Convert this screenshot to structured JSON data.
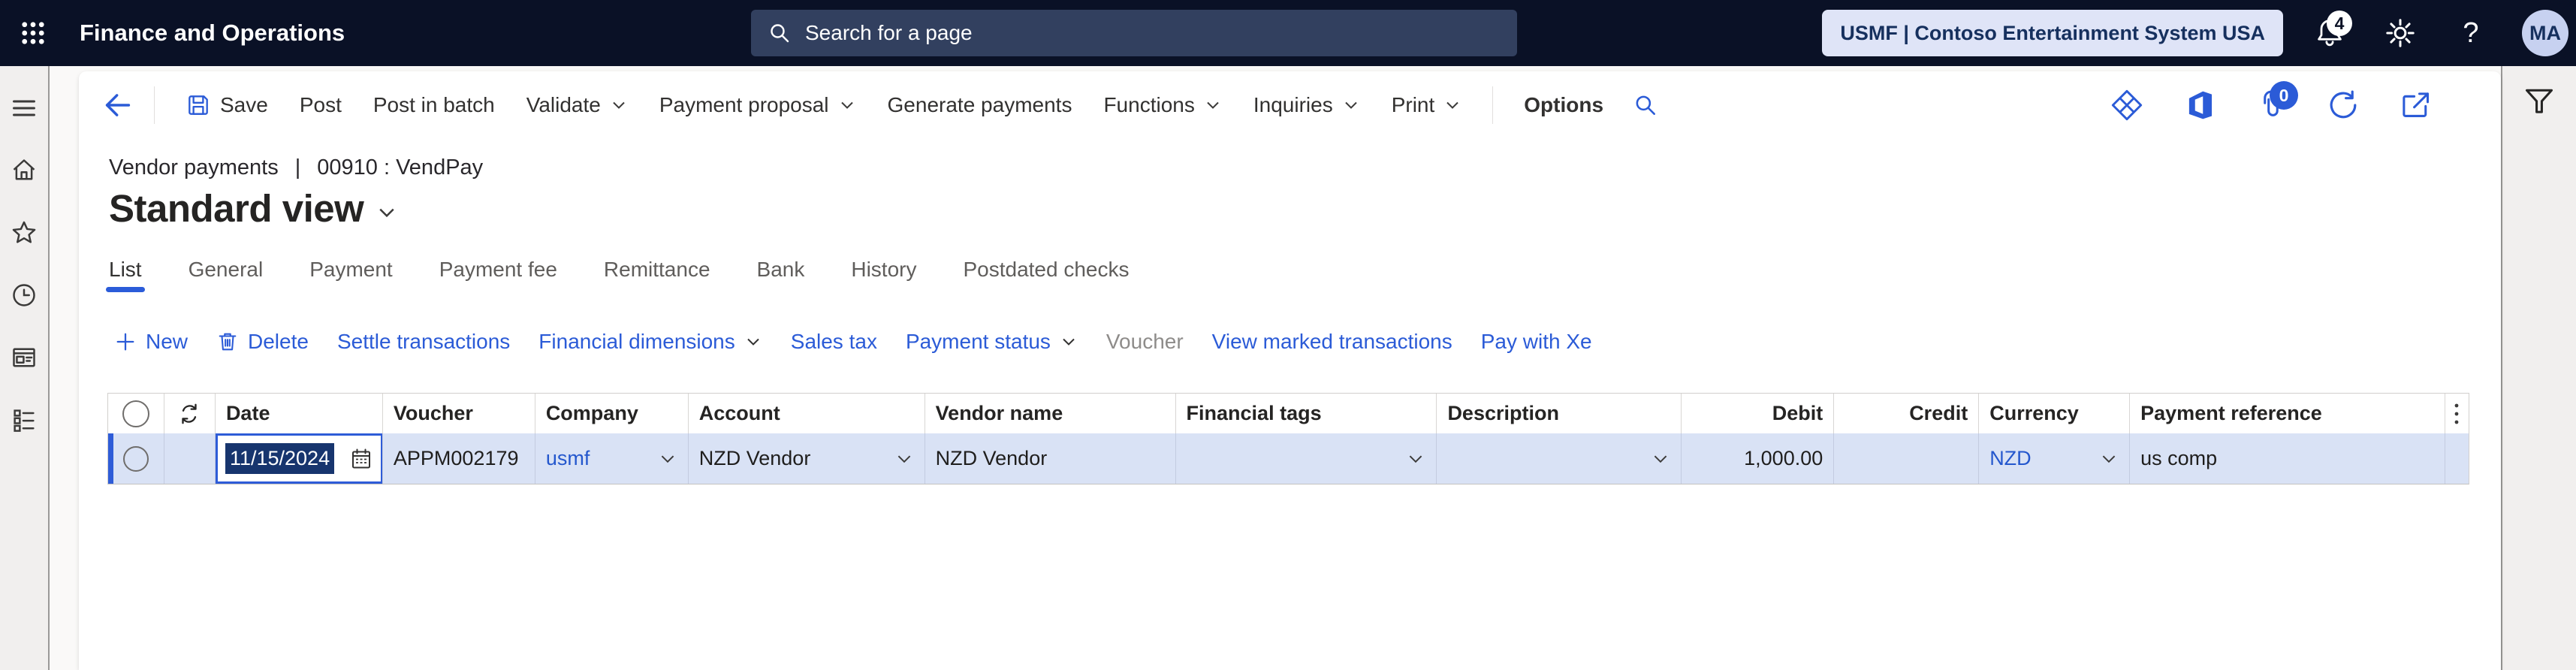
{
  "colors": {
    "topbar_bg": "#0a1126",
    "accent_blue": "#2b5bd7",
    "link_blue": "#2457cd",
    "row_selection_bg": "#d9e2f5",
    "environment_pill_bg": "#dfe4f7",
    "tab_underline": "#2b5cd9"
  },
  "topbar": {
    "app_title": "Finance and Operations",
    "search_placeholder": "Search for a page",
    "environment": "USMF | Contoso Entertainment System USA",
    "notification_count": "4",
    "help_label": "?",
    "avatar_initials": "MA"
  },
  "action_pane": {
    "save": "Save",
    "post": "Post",
    "post_in_batch": "Post in batch",
    "validate": "Validate",
    "payment_proposal": "Payment proposal",
    "generate_payments": "Generate payments",
    "functions": "Functions",
    "inquiries": "Inquiries",
    "print": "Print",
    "options": "Options",
    "attachments_count": "0"
  },
  "breadcrumb": {
    "page": "Vendor payments",
    "separator": "|",
    "record": "00910 : VendPay"
  },
  "page": {
    "title": "Standard view"
  },
  "tabs": [
    {
      "label": "List"
    },
    {
      "label": "General"
    },
    {
      "label": "Payment"
    },
    {
      "label": "Payment fee"
    },
    {
      "label": "Remittance"
    },
    {
      "label": "Bank"
    },
    {
      "label": "History"
    },
    {
      "label": "Postdated checks"
    }
  ],
  "toolbar": {
    "new": "New",
    "delete": "Delete",
    "settle_transactions": "Settle transactions",
    "financial_dimensions": "Financial dimensions",
    "sales_tax": "Sales tax",
    "payment_status": "Payment status",
    "voucher": "Voucher",
    "view_marked_transactions": "View marked transactions",
    "pay_with_xe": "Pay with Xe"
  },
  "grid": {
    "headers": [
      "Date",
      "Voucher",
      "Company",
      "Account",
      "Vendor name",
      "Financial tags",
      "Description",
      "Debit",
      "Credit",
      "Currency",
      "Payment reference"
    ],
    "row": {
      "date": "11/15/2024",
      "voucher": "APPM002179",
      "company": "usmf",
      "account": "NZD Vendor",
      "vendor_name": "NZD Vendor",
      "financial_tags": "",
      "description": "",
      "debit": "1,000.00",
      "credit": "",
      "currency": "NZD",
      "payment_reference": "us comp"
    }
  },
  "icons": {
    "app_launcher": "waffle-grid",
    "search": "magnifier",
    "notifications": "bell",
    "settings": "gear",
    "back": "arrow-left",
    "save": "floppy-disk",
    "new": "plus",
    "delete": "trash",
    "dropdown": "chevron-down",
    "attachments": "paperclip",
    "refresh": "circular-arrows",
    "open_in_new_window": "box-arrow",
    "office": "office-logo",
    "power_platform": "diamond-grid",
    "filter": "funnel",
    "calendar": "calendar-grid",
    "more_columns": "kebab-dots"
  }
}
